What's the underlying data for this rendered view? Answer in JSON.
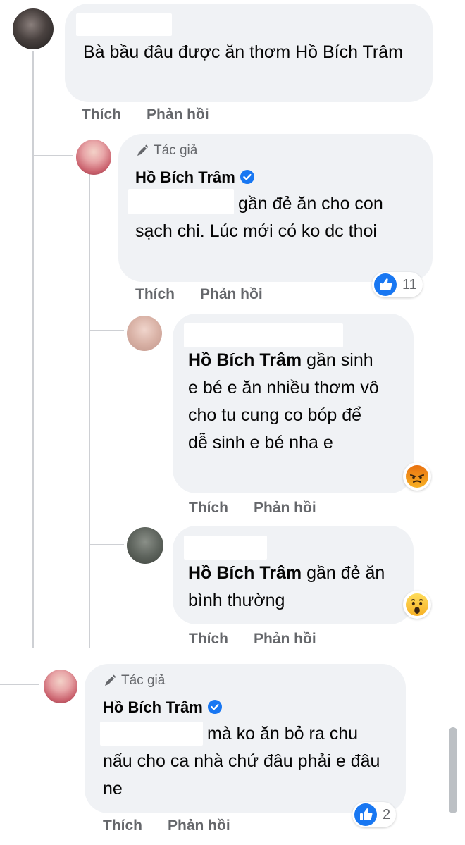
{
  "comments": [
    {
      "text": "Bà bầu đâu được ăn thơm Hồ Bích Trâm",
      "actions": {
        "like": "Thích",
        "reply": "Phản hồi"
      }
    },
    {
      "author_tag": "Tác giả",
      "name": "Hồ Bích Trâm",
      "text": "gần đẻ ăn cho con sạch chi. Lúc mới có ko dc thoi",
      "reaction": {
        "icon": "like-icon",
        "count": "11"
      },
      "actions": {
        "like": "Thích",
        "reply": "Phản hồi"
      }
    },
    {
      "mention": "Hồ Bích Trâm",
      "text": "gần sinh e bé e ăn nhiều thơm vô cho tu cung co bóp để dễ sinh e bé nha e",
      "reaction": {
        "icon": "angry-icon"
      },
      "actions": {
        "like": "Thích",
        "reply": "Phản hồi"
      }
    },
    {
      "mention": "Hồ Bích Trâm",
      "text": "gần đẻ ăn bình thường",
      "reaction": {
        "icon": "wow-icon"
      },
      "actions": {
        "like": "Thích",
        "reply": "Phản hồi"
      }
    },
    {
      "author_tag": "Tác giả",
      "name": "Hồ Bích Trâm",
      "text": "mà ko ăn bỏ ra chu nấu cho ca nhà chứ đâu phải e đâu ne",
      "reaction": {
        "icon": "like-icon",
        "count": "2"
      },
      "actions": {
        "like": "Thích",
        "reply": "Phản hồi"
      }
    }
  ],
  "colors": {
    "bubble": "#f0f2f5",
    "action": "#65676b",
    "like": "#1877f2",
    "verified": "#1877f2"
  }
}
